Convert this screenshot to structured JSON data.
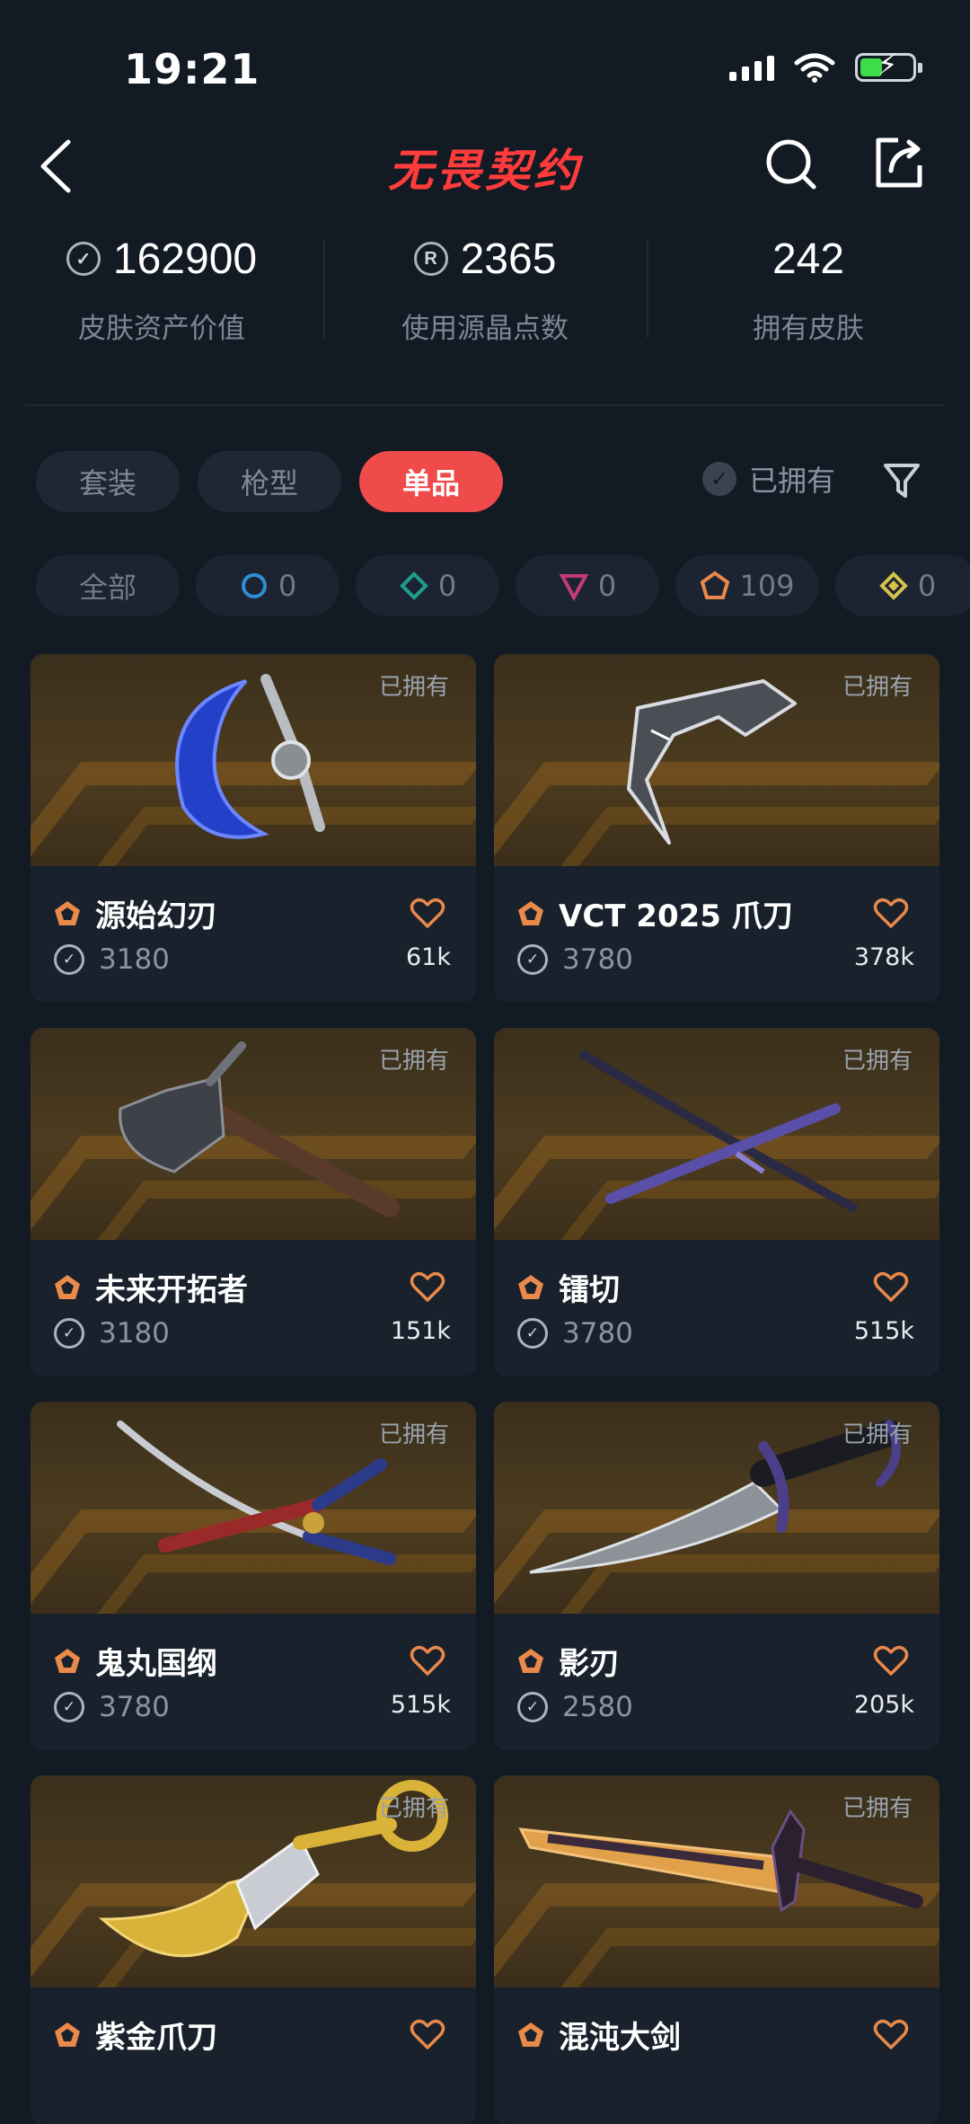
{
  "status_bar": {
    "time": "19:21"
  },
  "header": {
    "title": "无畏契约"
  },
  "stats": [
    {
      "value": "162900",
      "label": "皮肤资产价值",
      "icon": "vp-coin-icon"
    },
    {
      "value": "2365",
      "label": "使用源晶点数",
      "icon": "radianite-icon",
      "icon_glyph": "R"
    },
    {
      "value": "242",
      "label": "拥有皮肤"
    }
  ],
  "tabs": [
    {
      "label": "套装",
      "active": false
    },
    {
      "label": "枪型",
      "active": false
    },
    {
      "label": "单品",
      "active": true
    }
  ],
  "owned_filter": {
    "label": "已拥有"
  },
  "tier_chips": [
    {
      "label": "全部"
    },
    {
      "count": "0",
      "tier": "select",
      "color": "#2f8fd6"
    },
    {
      "count": "0",
      "tier": "deluxe",
      "color": "#1f9e8e"
    },
    {
      "count": "0",
      "tier": "premium",
      "color": "#c43a7a"
    },
    {
      "count": "109",
      "tier": "exclusive",
      "color": "#e9894a"
    },
    {
      "count": "0",
      "tier": "ultra",
      "color": "#d5c24a"
    }
  ],
  "items": [
    {
      "name": "源始幻刃",
      "price": "3180",
      "likes": "61k",
      "owned": "已拥有",
      "weapon": "crescent-blade"
    },
    {
      "name": "VCT 2025 爪刀",
      "price": "3780",
      "likes": "378k",
      "owned": "已拥有",
      "weapon": "claw-blade"
    },
    {
      "name": "未来开拓者",
      "price": "3180",
      "likes": "151k",
      "owned": "已拥有",
      "weapon": "axe"
    },
    {
      "name": "镭切",
      "price": "3780",
      "likes": "515k",
      "owned": "已拥有",
      "weapon": "dual-katana"
    },
    {
      "name": "鬼丸国纲",
      "price": "3780",
      "likes": "515k",
      "owned": "已拥有",
      "weapon": "katana"
    },
    {
      "name": "影刃",
      "price": "2580",
      "likes": "205k",
      "owned": "已拥有",
      "weapon": "dagger"
    },
    {
      "name": "紫金爪刀",
      "price": "",
      "likes": "",
      "owned": "已拥有",
      "weapon": "karambit"
    },
    {
      "name": "混沌大剑",
      "price": "",
      "likes": "",
      "owned": "已拥有",
      "weapon": "greatsword"
    }
  ]
}
